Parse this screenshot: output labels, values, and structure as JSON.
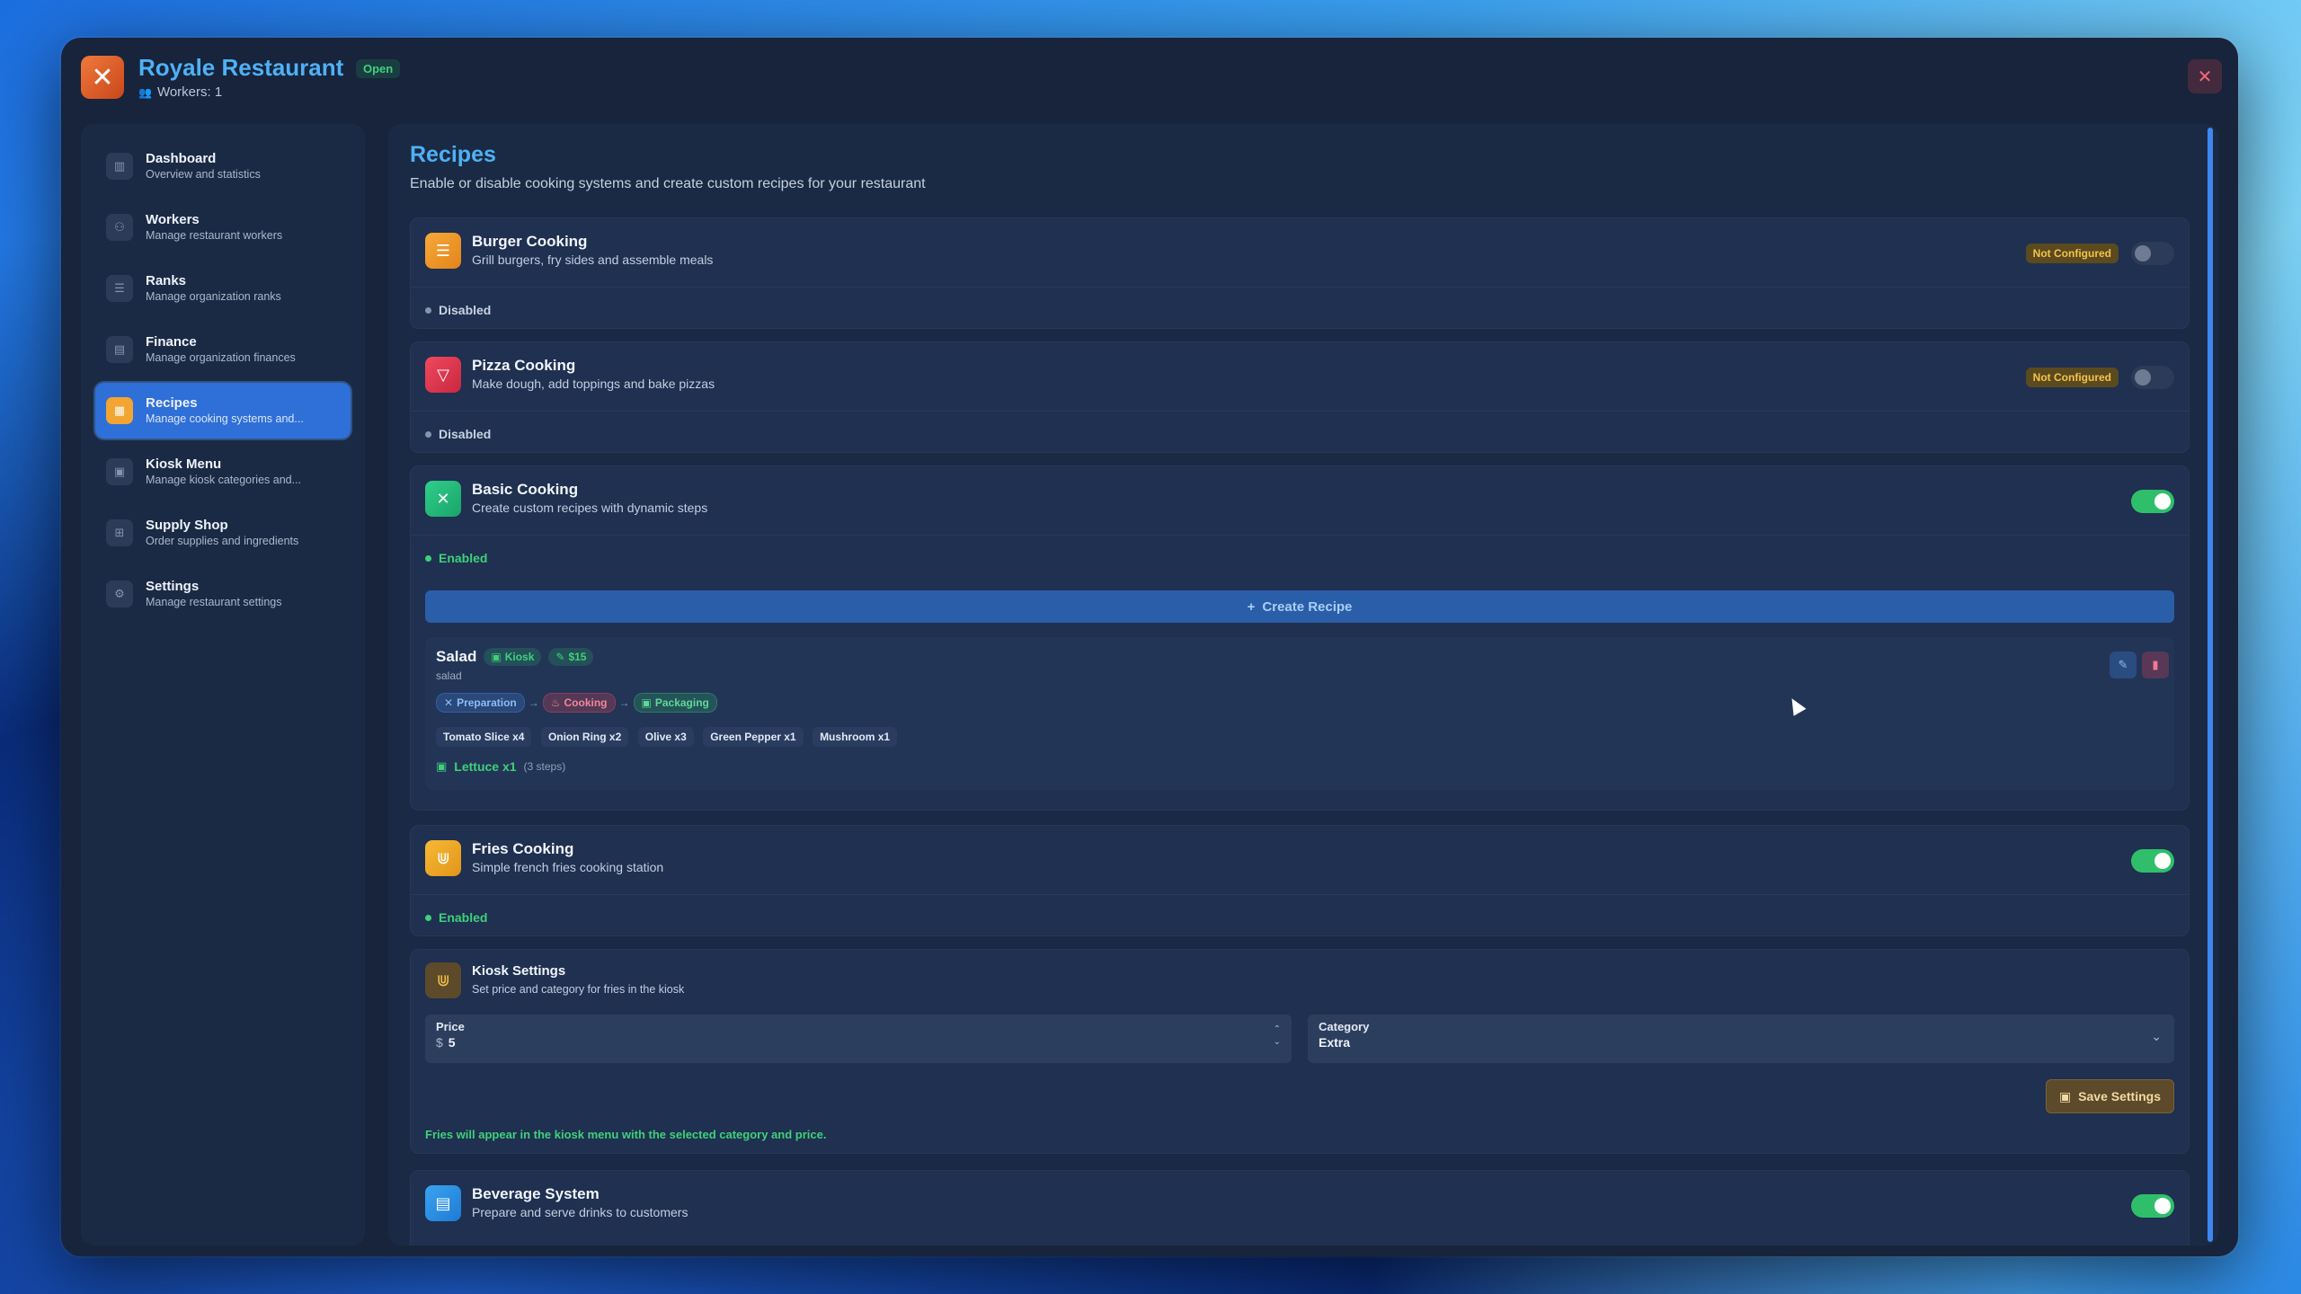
{
  "app": {
    "title": "Royale Restaurant",
    "status": "Open",
    "workers": "Workers: 1",
    "close_glyph": "✕"
  },
  "sidebar": {
    "items": [
      {
        "title": "Dashboard",
        "sub": "Overview and statistics",
        "icon": "chart-icon"
      },
      {
        "title": "Workers",
        "sub": "Manage restaurant workers",
        "icon": "users-icon"
      },
      {
        "title": "Ranks",
        "sub": "Manage organization ranks",
        "icon": "list-icon"
      },
      {
        "title": "Finance",
        "sub": "Manage organization finances",
        "icon": "card-icon"
      },
      {
        "title": "Recipes",
        "sub": "Manage cooking systems and...",
        "icon": "book-icon",
        "active": true
      },
      {
        "title": "Kiosk Menu",
        "sub": "Manage kiosk categories and...",
        "icon": "kiosk-icon"
      },
      {
        "title": "Supply Shop",
        "sub": "Order supplies and ingredients",
        "icon": "cart-icon"
      },
      {
        "title": "Settings",
        "sub": "Manage restaurant settings",
        "icon": "gear-icon"
      }
    ]
  },
  "main": {
    "title": "Recipes",
    "subtitle": "Enable or disable cooking systems and create custom recipes for your restaurant",
    "systems": {
      "burger": {
        "title": "Burger Cooking",
        "sub": "Grill burgers, fry sides and assemble meals",
        "badge": "Not Configured",
        "status": "Disabled"
      },
      "pizza": {
        "title": "Pizza Cooking",
        "sub": "Make dough, add toppings and bake pizzas",
        "badge": "Not Configured",
        "status": "Disabled"
      },
      "basic": {
        "title": "Basic Cooking",
        "sub": "Create custom recipes with dynamic steps",
        "status": "Enabled",
        "create_label": "Create Recipe"
      },
      "fries": {
        "title": "Fries Cooking",
        "sub": "Simple french fries cooking station",
        "status": "Enabled"
      },
      "beverage": {
        "title": "Beverage System",
        "sub": "Prepare and serve drinks to customers"
      }
    },
    "recipe": {
      "name": "Salad",
      "id": "salad",
      "kiosk_badge": "Kiosk",
      "price_badge": "$15",
      "steps": [
        "Preparation",
        "Cooking",
        "Packaging"
      ],
      "ingredients": [
        "Tomato Slice x4",
        "Onion Ring x2",
        "Olive x3",
        "Green Pepper x1",
        "Mushroom x1"
      ],
      "result": "Lettuce x1",
      "step_count": "(3 steps)"
    },
    "kiosk_settings": {
      "title": "Kiosk Settings",
      "sub": "Set price and category for fries in the kiosk",
      "price_label": "Price",
      "price_prefix": "$",
      "price_value": "5",
      "category_label": "Category",
      "category_value": "Extra",
      "save_label": "Save Settings",
      "note": "Fries will appear in the kiosk menu with the selected category and price."
    }
  },
  "colors": {
    "accent": "#4fb0f5",
    "enabled": "#3fd07a",
    "disabled": "#8394ad",
    "warning": "#f6c24a"
  }
}
